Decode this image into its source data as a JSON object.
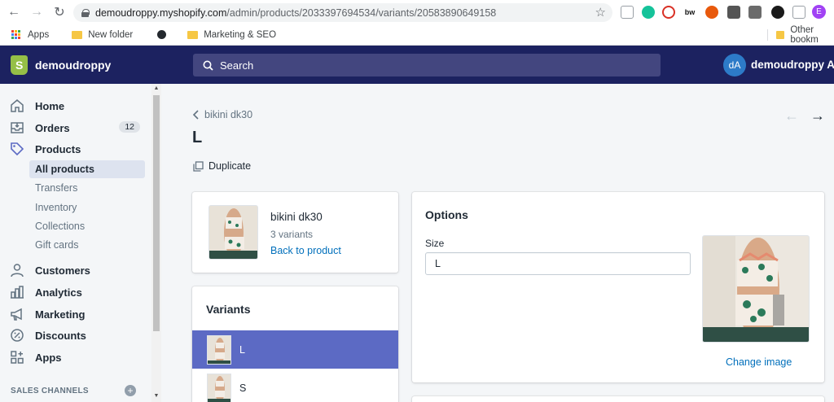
{
  "browser": {
    "url_host": "demoudroppy.myshopify.com",
    "url_path": "/admin/products/2033397694534/variants/20583890649158",
    "profile_initial": "E",
    "bookmarks": [
      "Apps",
      "New folder",
      "",
      "Marketing & SEO"
    ],
    "bookmarks_right": "Other bookm"
  },
  "topbar": {
    "shop_name": "demoudroppy",
    "search_placeholder": "Search",
    "avatar_initials": "dA",
    "account_name": "demoudroppy Adm"
  },
  "sidebar": {
    "items": [
      {
        "label": "Home",
        "icon": "home-icon"
      },
      {
        "label": "Orders",
        "icon": "orders-icon",
        "badge": "12"
      },
      {
        "label": "Products",
        "icon": "tag-icon"
      }
    ],
    "product_subitems": [
      "All products",
      "Transfers",
      "Inventory",
      "Collections",
      "Gift cards"
    ],
    "items2": [
      {
        "label": "Customers",
        "icon": "person-icon"
      },
      {
        "label": "Analytics",
        "icon": "bar-chart-icon"
      },
      {
        "label": "Marketing",
        "icon": "megaphone-icon"
      },
      {
        "label": "Discounts",
        "icon": "discount-icon"
      },
      {
        "label": "Apps",
        "icon": "apps-icon"
      }
    ],
    "sales_channels": "SALES CHANNELS"
  },
  "page": {
    "breadcrumb": "bikini dk30",
    "title": "L",
    "duplicate_label": "Duplicate"
  },
  "product_card": {
    "name": "bikini dk30",
    "variant_count": "3 variants",
    "back_link": "Back to product"
  },
  "variants_card": {
    "title": "Variants",
    "rows": [
      "L",
      "S"
    ]
  },
  "options_card": {
    "title": "Options",
    "field_label": "Size",
    "field_value": "L",
    "change_image": "Change image"
  },
  "colors": {
    "topbar": "#1c2260",
    "selected_variant": "#5c6ac4",
    "link": "#006fbb"
  }
}
